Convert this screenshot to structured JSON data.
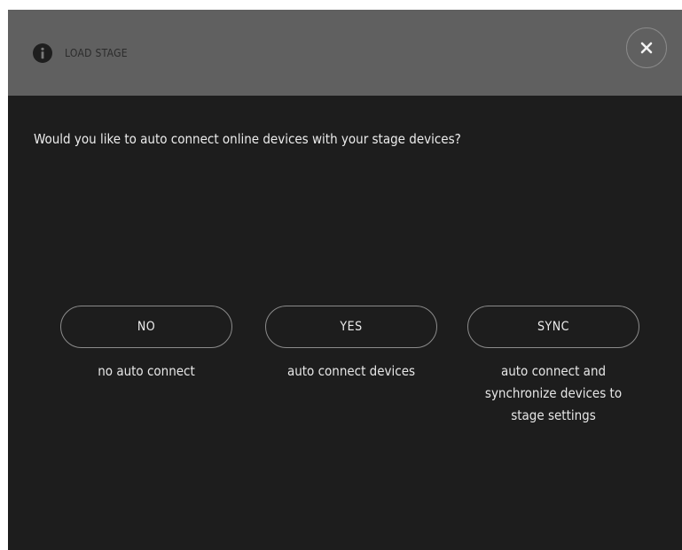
{
  "dialog": {
    "title": "LOAD STAGE",
    "info_icon": "info-icon",
    "close_icon": "close-icon",
    "question": "Would you like to auto connect online devices with your stage devices?"
  },
  "options": [
    {
      "label": "NO",
      "description": "no auto connect"
    },
    {
      "label": "YES",
      "description": "auto connect devices"
    },
    {
      "label": "SYNC",
      "description": "auto connect and synchronize devices to stage settings"
    }
  ],
  "colors": {
    "header_bg": "#606060",
    "dialog_bg": "#1d1d1d",
    "text": "#ececec",
    "button_border": "#8b8b8b"
  }
}
